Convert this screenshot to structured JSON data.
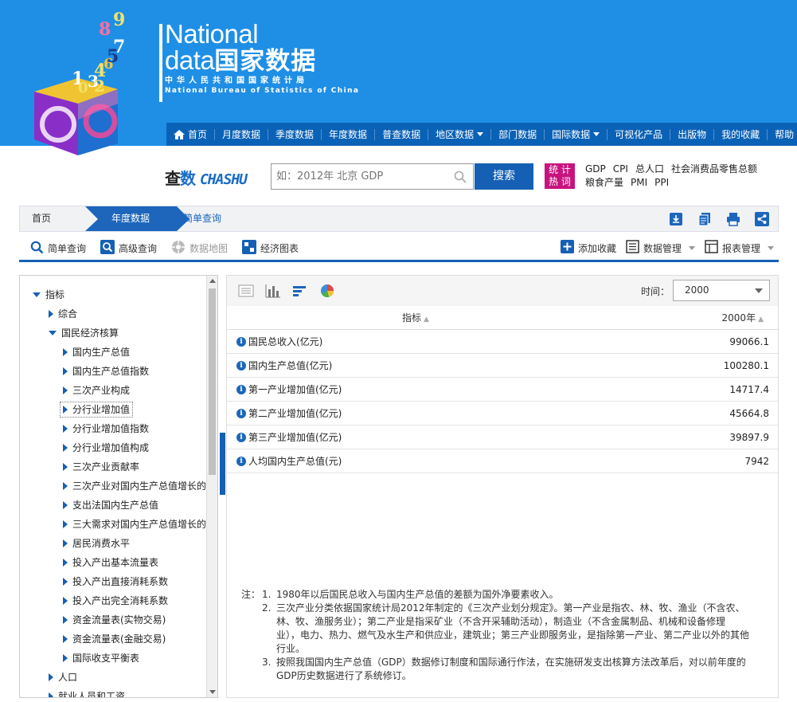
{
  "brand": {
    "line1": "National",
    "line2_en": "data",
    "line2_cn": "国家数据",
    "line3": "中华人民共和国国家统计局",
    "line4": "National Bureau of Statistics of China",
    "logo_numbers": [
      "9",
      "8",
      "7",
      "6",
      "5",
      "4",
      "3",
      "2",
      "1",
      "0"
    ]
  },
  "nav": {
    "items": [
      {
        "label": "首页",
        "dropdown": false
      },
      {
        "label": "月度数据",
        "dropdown": false
      },
      {
        "label": "季度数据",
        "dropdown": false
      },
      {
        "label": "年度数据",
        "dropdown": false
      },
      {
        "label": "普查数据",
        "dropdown": false
      },
      {
        "label": "地区数据",
        "dropdown": true
      },
      {
        "label": "部门数据",
        "dropdown": false
      },
      {
        "label": "国际数据",
        "dropdown": true
      },
      {
        "label": "可视化产品",
        "dropdown": false
      },
      {
        "label": "出版物",
        "dropdown": false
      },
      {
        "label": "我的收藏",
        "dropdown": false
      },
      {
        "label": "帮助",
        "dropdown": false
      }
    ]
  },
  "search": {
    "logo_cn1": "查",
    "logo_cn2": "数",
    "logo_en": "CHASHU",
    "placeholder": "如：2012年 北京 GDP",
    "button": "搜索",
    "hot_badge_line1": "统 计",
    "hot_badge_line2": "热 词",
    "hot_words": [
      "GDP",
      "CPI",
      "总人口",
      "社会消费品零售总额",
      "粮食产量",
      "PMI",
      "PPI"
    ]
  },
  "breadcrumb": {
    "home": "首页",
    "year": "年度数据",
    "simple": "简单查询"
  },
  "toolbar": {
    "simple_query": "简单查询",
    "advanced_query": "高级查询",
    "data_map": "数据地图",
    "econ_chart": "经济图表",
    "add_favorite": "添加收藏",
    "data_manage": "数据管理",
    "report_manage": "报表管理"
  },
  "tree": [
    {
      "label": "指标",
      "level": 0,
      "expanded": true
    },
    {
      "label": "综合",
      "level": 1,
      "expanded": false
    },
    {
      "label": "国民经济核算",
      "level": 1,
      "expanded": true
    },
    {
      "label": "国内生产总值",
      "level": 2,
      "expanded": false
    },
    {
      "label": "国内生产总值指数",
      "level": 2,
      "expanded": false
    },
    {
      "label": "三次产业构成",
      "level": 2,
      "expanded": false
    },
    {
      "label": "分行业增加值",
      "level": 2,
      "expanded": false,
      "selected": true
    },
    {
      "label": "分行业增加值指数",
      "level": 2,
      "expanded": false
    },
    {
      "label": "分行业增加值构成",
      "level": 2,
      "expanded": false
    },
    {
      "label": "三次产业贡献率",
      "level": 2,
      "expanded": false
    },
    {
      "label": "三次产业对国内生产总值增长的",
      "level": 2,
      "expanded": false
    },
    {
      "label": "支出法国内生产总值",
      "level": 2,
      "expanded": false
    },
    {
      "label": "三大需求对国内生产总值增长的",
      "level": 2,
      "expanded": false
    },
    {
      "label": "居民消费水平",
      "level": 2,
      "expanded": false
    },
    {
      "label": "投入产出基本流量表",
      "level": 2,
      "expanded": false
    },
    {
      "label": "投入产出直接消耗系数",
      "level": 2,
      "expanded": false
    },
    {
      "label": "投入产出完全消耗系数",
      "level": 2,
      "expanded": false
    },
    {
      "label": "资金流量表(实物交易)",
      "level": 2,
      "expanded": false
    },
    {
      "label": "资金流量表(金融交易)",
      "level": 2,
      "expanded": false
    },
    {
      "label": "国际收支平衡表",
      "level": 2,
      "expanded": false
    },
    {
      "label": "人口",
      "level": 1,
      "expanded": false
    },
    {
      "label": "就业人员和工资",
      "level": 1,
      "expanded": false
    }
  ],
  "main": {
    "time_label": "时间：",
    "time_value": "2000",
    "col_indicator": "指标",
    "col_year": "2000年",
    "rows": [
      {
        "name": "国民总收入(亿元)",
        "value": "99066.1"
      },
      {
        "name": "国内生产总值(亿元)",
        "value": "100280.1"
      },
      {
        "name": "第一产业增加值(亿元)",
        "value": "14717.4"
      },
      {
        "name": "第二产业增加值(亿元)",
        "value": "45664.8"
      },
      {
        "name": "第三产业增加值(亿元)",
        "value": "39897.9"
      },
      {
        "name": "人均国内生产总值(元)",
        "value": "7942"
      }
    ],
    "notes_label": "注：",
    "notes": [
      {
        "num": "1.",
        "lines": [
          "1980年以后国民总收入与国内生产总值的差额为国外净要素收入。"
        ]
      },
      {
        "num": "2.",
        "lines": [
          "三次产业分类依据国家统计局2012年制定的《三次产业划分规定》。第一产业是指农、林、牧、渔业（不含农、",
          "林、牧、渔服务业）；第二产业是指采矿业（不含开采辅助活动），制造业（不含金属制品、机械和设备修理",
          "业），电力、热力、燃气及水生产和供应业，建筑业；第三产业即服务业，是指除第一产业、第二产业以外的其他",
          "行业。"
        ]
      },
      {
        "num": "3.",
        "lines": [
          "按照我国国内生产总值（GDP）数据修订制度和国际通行作法，在实施研发支出核算方法改革后，对以前年度的",
          "GDP历史数据进行了系统修订。"
        ]
      }
    ]
  },
  "colors": {
    "header_bg": "#1f8fe6",
    "nav_bg": "#0a62b6",
    "accent": "#1560b4",
    "hot_badge": "#c8137f"
  }
}
